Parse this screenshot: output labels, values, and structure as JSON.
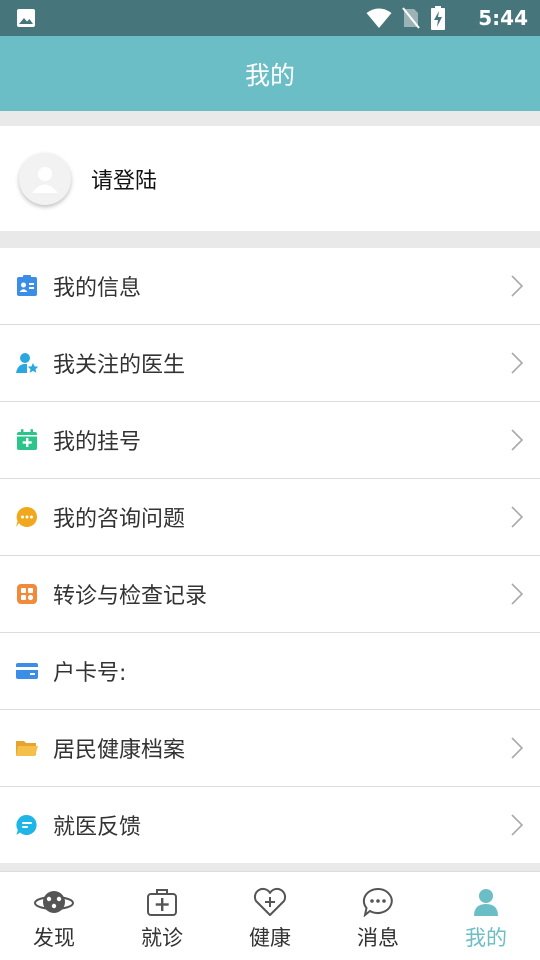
{
  "status_bar": {
    "time": "5:44"
  },
  "header": {
    "title": "我的"
  },
  "profile": {
    "login_text": "请登陆"
  },
  "menu": {
    "items": [
      {
        "label": "我的信息",
        "icon": "id-card-icon",
        "color": "#3b8ee8",
        "chevron": true
      },
      {
        "label": "我关注的医生",
        "icon": "doctor-star-icon",
        "color": "#2aa7e0",
        "chevron": true
      },
      {
        "label": "我的挂号",
        "icon": "calendar-plus-icon",
        "color": "#2bc48a",
        "chevron": true
      },
      {
        "label": "我的咨询问题",
        "icon": "chat-bubble-icon",
        "color": "#f2a81d",
        "chevron": true
      },
      {
        "label": "转诊与检查记录",
        "icon": "records-icon",
        "color": "#f28a3c",
        "chevron": true
      },
      {
        "label": "户卡号:",
        "icon": "card-icon",
        "color": "#3b8ee8",
        "chevron": false
      },
      {
        "label": "居民健康档案",
        "icon": "folder-icon",
        "color": "#e8a32a",
        "chevron": true
      },
      {
        "label": "就医反馈",
        "icon": "feedback-icon",
        "color": "#1fb5e8",
        "chevron": true
      }
    ]
  },
  "tab_bar": {
    "tabs": [
      {
        "label": "发现",
        "icon": "planet-icon",
        "active": false
      },
      {
        "label": "就诊",
        "icon": "medical-kit-icon",
        "active": false
      },
      {
        "label": "健康",
        "icon": "heart-plus-icon",
        "active": false
      },
      {
        "label": "消息",
        "icon": "message-icon",
        "active": false
      },
      {
        "label": "我的",
        "icon": "person-icon",
        "active": true
      }
    ],
    "active_color": "#6bbdc6"
  }
}
